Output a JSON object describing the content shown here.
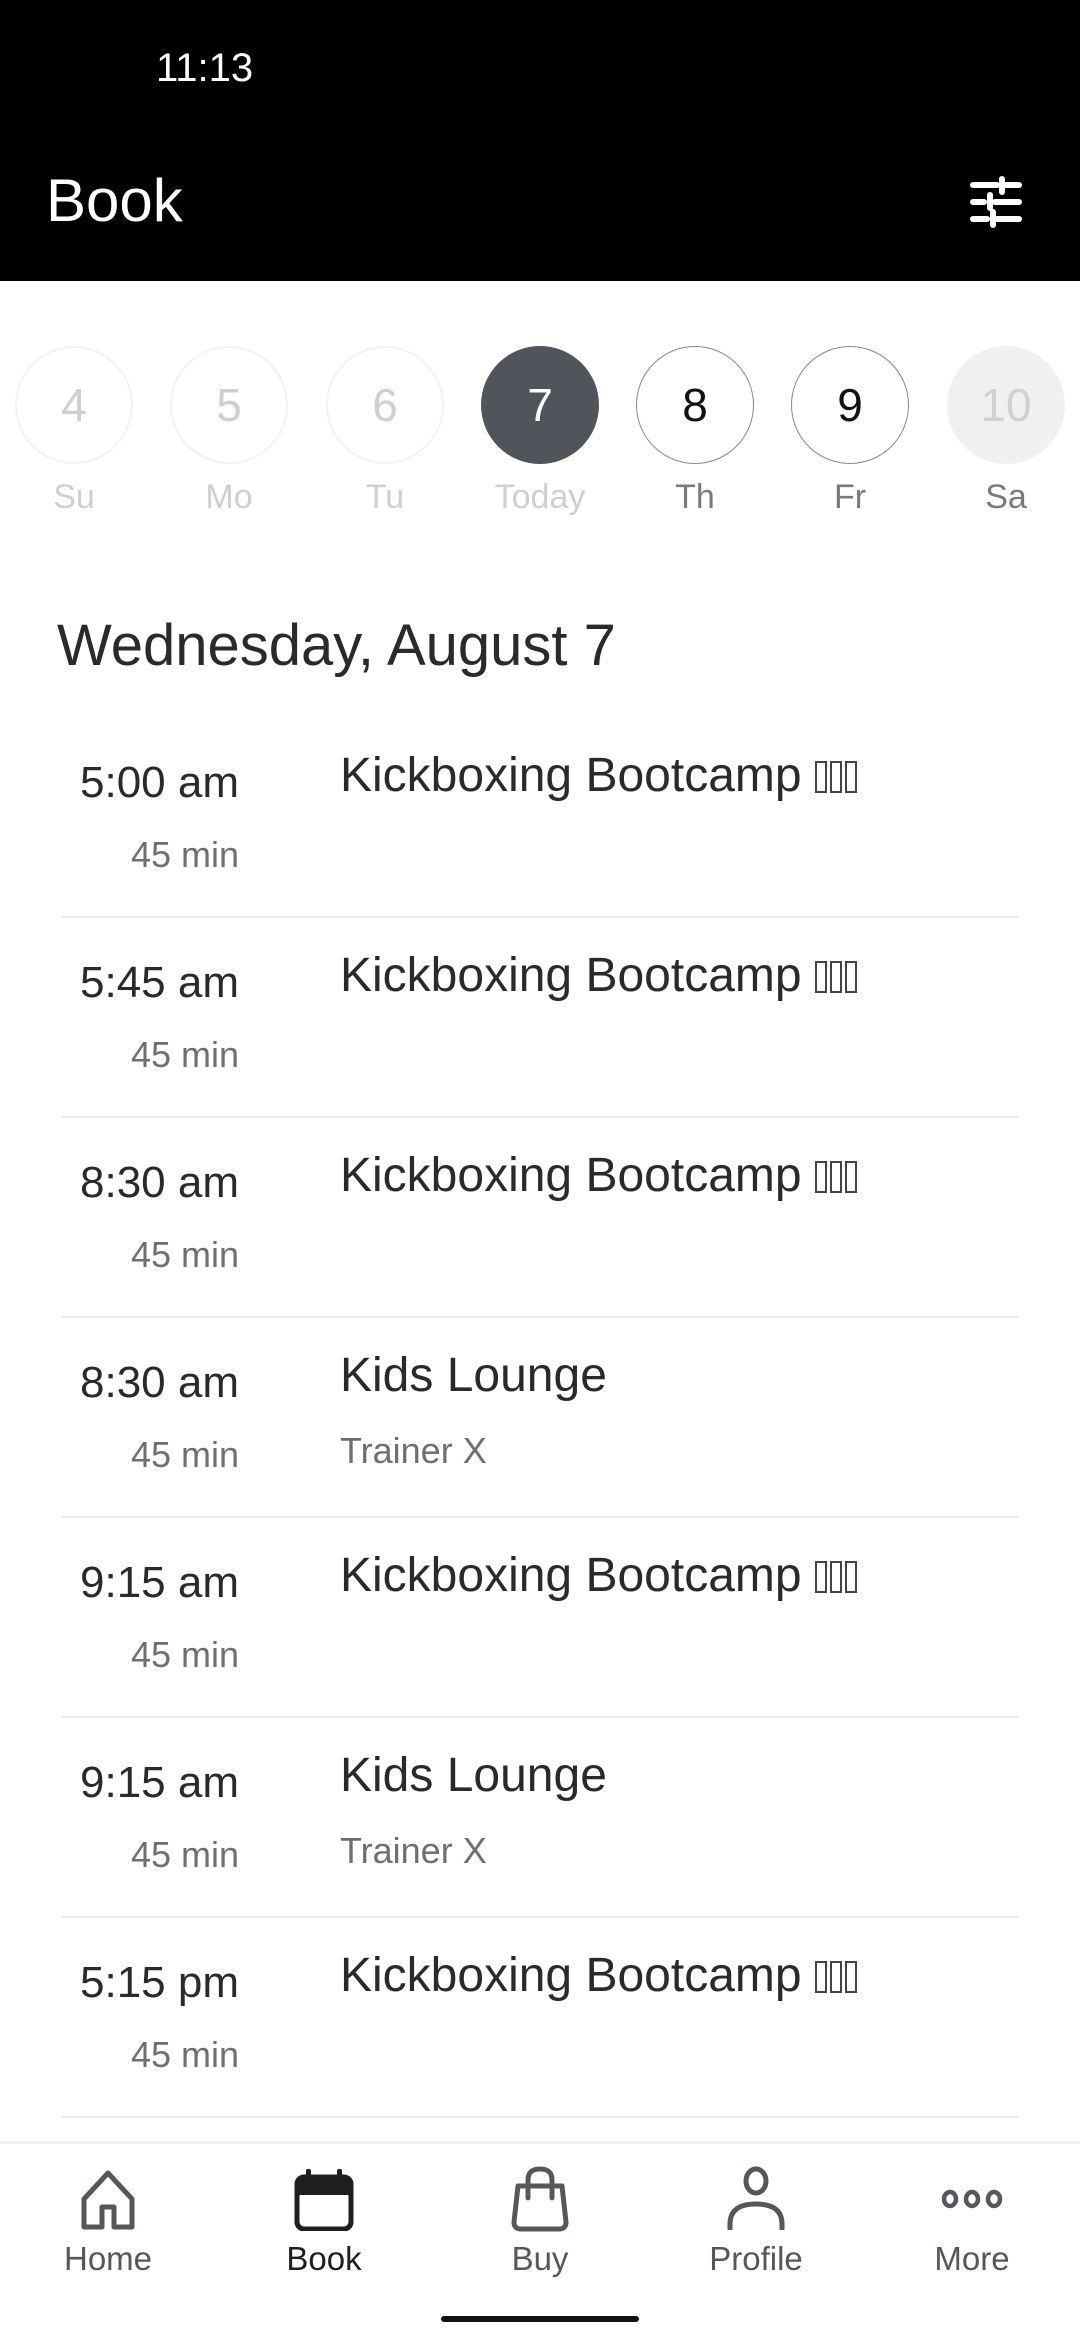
{
  "status_bar": {
    "time": "11:13"
  },
  "header": {
    "title": "Book",
    "filter_icon": "sliders-icon"
  },
  "colors": {
    "header_bg": "#000000",
    "today_circle": "#51545b",
    "muted_text": "#6e6e73",
    "divider": "#ebebeb"
  },
  "date_strip": [
    {
      "day": "4",
      "label": "Su",
      "state": "past"
    },
    {
      "day": "5",
      "label": "Mo",
      "state": "past"
    },
    {
      "day": "6",
      "label": "Tu",
      "state": "past"
    },
    {
      "day": "7",
      "label": "Today",
      "state": "selected"
    },
    {
      "day": "8",
      "label": "Th",
      "state": "future"
    },
    {
      "day": "9",
      "label": "Fr",
      "state": "future"
    },
    {
      "day": "10",
      "label": "Sa",
      "state": "disabled"
    }
  ],
  "date_heading": "Wednesday, August 7",
  "classes": [
    {
      "time": "5:00 am",
      "duration": "45 min",
      "name": "Kickboxing Bootcamp",
      "emoji_placeholders": 3,
      "trainer": ""
    },
    {
      "time": "5:45 am",
      "duration": "45 min",
      "name": "Kickboxing Bootcamp",
      "emoji_placeholders": 3,
      "trainer": ""
    },
    {
      "time": "8:30 am",
      "duration": "45 min",
      "name": "Kickboxing Bootcamp",
      "emoji_placeholders": 3,
      "trainer": ""
    },
    {
      "time": "8:30 am",
      "duration": "45 min",
      "name": "Kids Lounge",
      "emoji_placeholders": 0,
      "trainer": "Trainer X"
    },
    {
      "time": "9:15 am",
      "duration": "45 min",
      "name": "Kickboxing Bootcamp",
      "emoji_placeholders": 3,
      "trainer": ""
    },
    {
      "time": "9:15 am",
      "duration": "45 min",
      "name": "Kids Lounge",
      "emoji_placeholders": 0,
      "trainer": "Trainer X"
    },
    {
      "time": "5:15 pm",
      "duration": "45 min",
      "name": "Kickboxing Bootcamp",
      "emoji_placeholders": 3,
      "trainer": ""
    }
  ],
  "bottom_nav": [
    {
      "label": "Home",
      "icon": "home-icon",
      "active": false
    },
    {
      "label": "Book",
      "icon": "calendar-icon",
      "active": true
    },
    {
      "label": "Buy",
      "icon": "shopping-bag-icon",
      "active": false
    },
    {
      "label": "Profile",
      "icon": "person-icon",
      "active": false
    },
    {
      "label": "More",
      "icon": "more-dots-icon",
      "active": false
    }
  ]
}
